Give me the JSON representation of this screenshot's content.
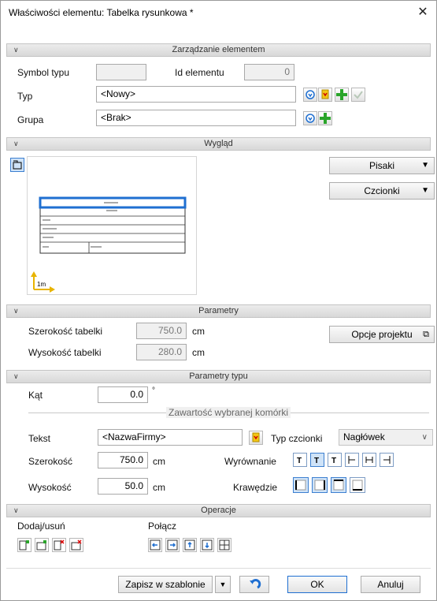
{
  "window": {
    "title": "Właściwości elementu: Tabelka rysunkowa *"
  },
  "sections": {
    "zarzadzanie": "Zarządzanie elementem",
    "wyglad": "Wygląd",
    "parametry": "Parametry",
    "parametry_typu": "Parametry typu",
    "operacje": "Operacje"
  },
  "zarzadzanie": {
    "symbol_label": "Symbol typu",
    "symbol_value": "",
    "id_label": "Id elementu",
    "id_value": "0",
    "typ_label": "Typ",
    "typ_value": "<Nowy>",
    "grupa_label": "Grupa",
    "grupa_value": "<Brak>"
  },
  "wyglad": {
    "pisaki": "Pisaki",
    "czcionki": "Czcionki",
    "scale_label": "1m"
  },
  "parametry": {
    "szer_label": "Szerokość tabelki",
    "szer_value": "750.0",
    "wys_label": "Wysokość tabelki",
    "wys_value": "280.0",
    "unit": "cm",
    "opcje": "Opcje projektu"
  },
  "parametry_typu": {
    "kat_label": "Kąt",
    "kat_value": "0.0",
    "kat_unit": "°",
    "group_label": "Zawartość wybranej komórki",
    "tekst_label": "Tekst",
    "tekst_value": "<NazwaFirmy>",
    "typ_czcionki_label": "Typ czcionki",
    "typ_czcionki_value": "Nagłówek",
    "szer_label": "Szerokość",
    "szer_value": "750.0",
    "wys_label": "Wysokość",
    "wys_value": "50.0",
    "unit": "cm",
    "wyrownanie_label": "Wyrównanie",
    "krawedzie_label": "Krawędzie"
  },
  "operacje": {
    "dodaj_label": "Dodaj/usuń",
    "polacz_label": "Połącz"
  },
  "footer": {
    "zapisz": "Zapisz w szablonie",
    "ok": "OK",
    "anuluj": "Anuluj"
  },
  "colors": {
    "accent": "#1f6fd1",
    "green": "#2aa52a",
    "yellow": "#f3c613"
  }
}
